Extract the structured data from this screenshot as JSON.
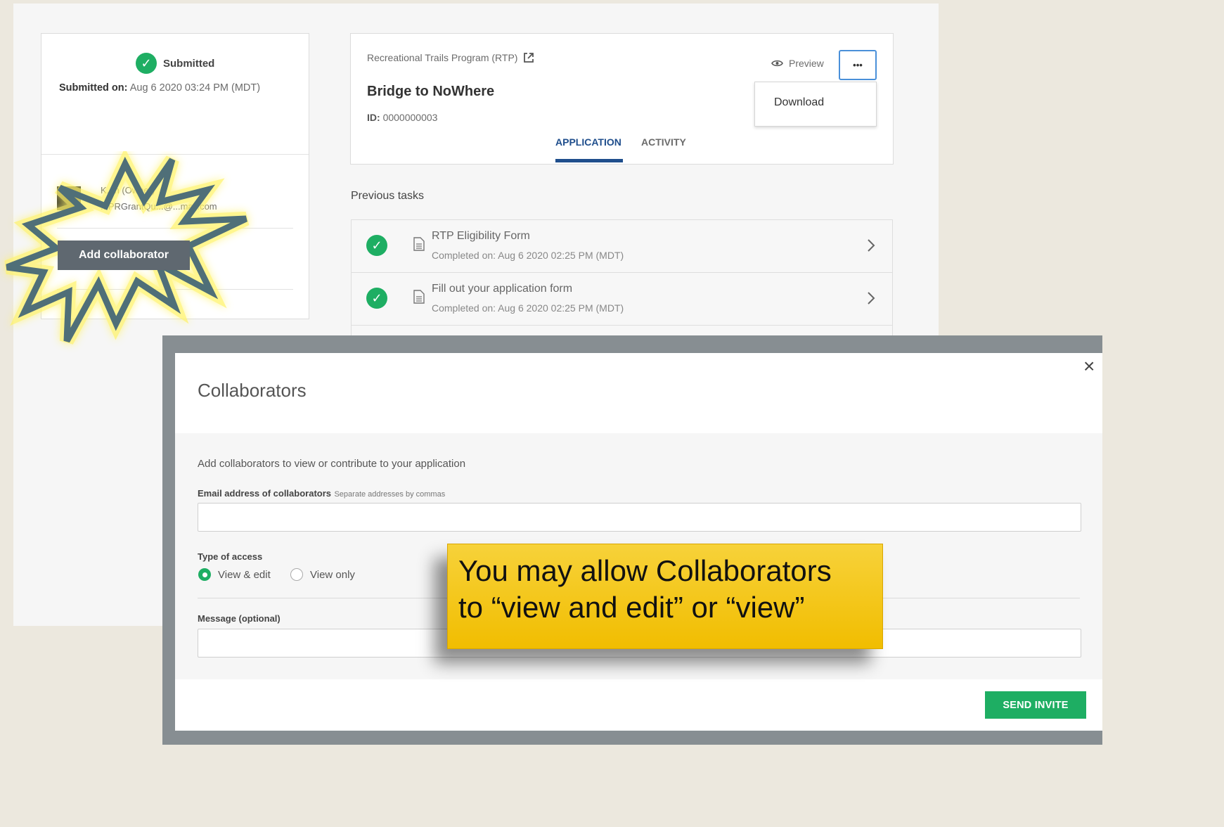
{
  "status": {
    "label": "Submitted",
    "submitted_on_label": "Submitted on:",
    "submitted_on_value": "Aug 6 2020 03:24 PM (MDT)"
  },
  "collaborator_panel": {
    "owner_text": "K...n (Owner)",
    "owner_email": "...PRGrantQu...@...mail.com",
    "add_button": "Add collaborator"
  },
  "application": {
    "program": "Recreational Trails Program (RTP)",
    "title": "Bridge to NoWhere",
    "id_label": "ID:",
    "id_value": "0000000003",
    "preview": "Preview",
    "more_label": "•••",
    "menu": {
      "download": "Download"
    },
    "tabs": [
      {
        "label": "APPLICATION"
      },
      {
        "label": "ACTIVITY"
      }
    ]
  },
  "previous_tasks": {
    "heading": "Previous tasks",
    "items": [
      {
        "title": "RTP Eligibility Form",
        "completed": "Completed on: Aug 6 2020 02:25 PM (MDT)"
      },
      {
        "title": "Fill out your application form",
        "completed": "Completed on: Aug 6 2020 02:25 PM (MDT)"
      }
    ]
  },
  "modal": {
    "title": "Collaborators",
    "close": "×",
    "intro": "Add collaborators to view or contribute to your application",
    "email_label": "Email address of collaborators",
    "email_hint": "Separate addresses by commas",
    "email_value": "",
    "access_label": "Type of access",
    "access_options": [
      {
        "label": "View & edit",
        "selected": true
      },
      {
        "label": "View only",
        "selected": false
      }
    ],
    "message_label": "Message (optional)",
    "message_value": "",
    "send_button": "SEND INVITE"
  },
  "callout": {
    "line1": "You may allow Collaborators",
    "line2": "to “view and edit” or “view”"
  },
  "colors": {
    "accent_green": "#1eae63",
    "tab_blue": "#1f4e8c",
    "callout_yellow": "#f4c400",
    "starburst": "#4f6f78"
  }
}
